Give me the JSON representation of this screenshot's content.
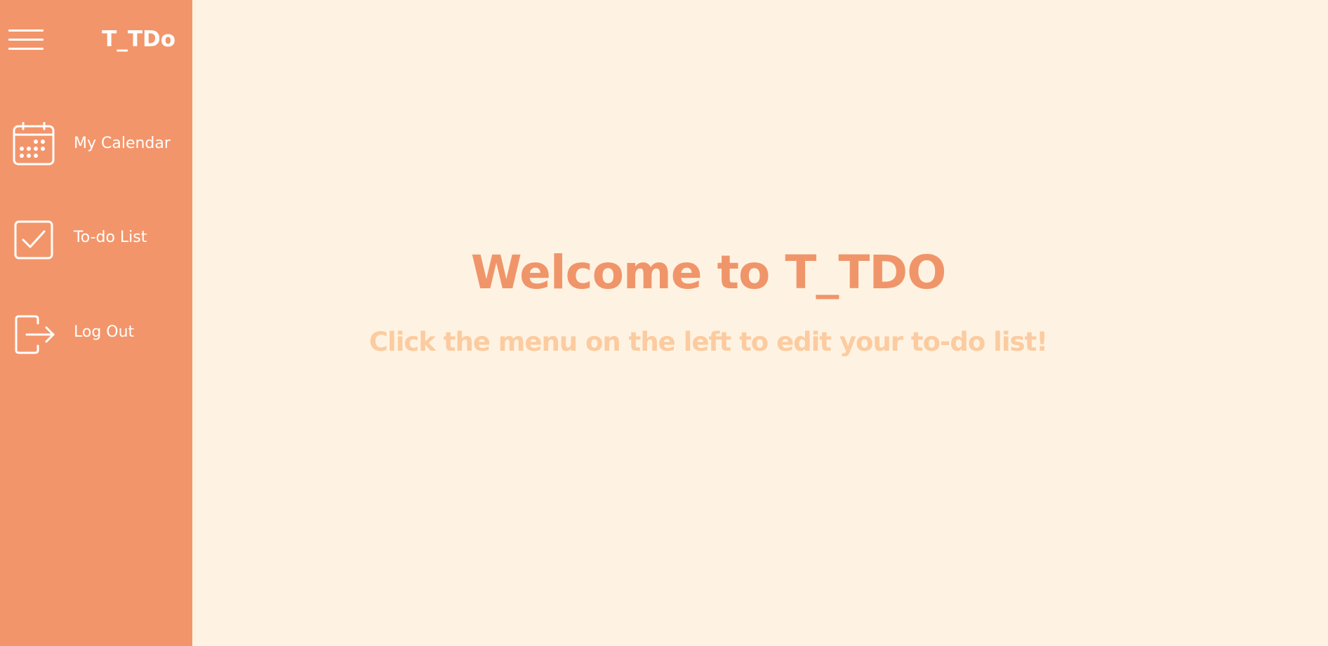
{
  "sidebar": {
    "brand": "T_TDo",
    "menu_icon": "hamburger-menu-icon",
    "items": [
      {
        "label": "My Calendar",
        "icon": "calendar-icon"
      },
      {
        "label": "To-do List",
        "icon": "checkbox-icon"
      },
      {
        "label": "Log Out",
        "icon": "logout-icon"
      }
    ]
  },
  "main": {
    "title": "Welcome to T_TDO",
    "subtitle": "Click the menu on the left to edit your to-do list!"
  },
  "colors": {
    "sidebar_bg": "#f3956a",
    "page_bg": "#fef3e2",
    "title": "#f0956a",
    "subtitle": "#fccba0",
    "sidebar_text": "#ffffff"
  }
}
